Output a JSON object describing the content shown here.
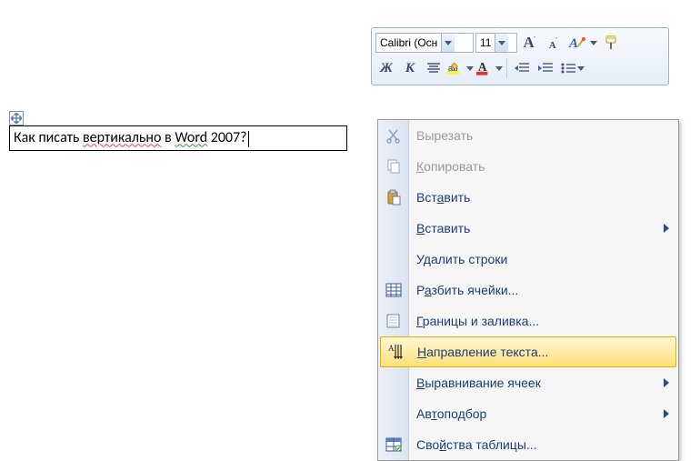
{
  "toolbar": {
    "font_name": "Calibri (Осн",
    "font_size": "11"
  },
  "cell": {
    "text_plain": "Как писать вертикально в Word 2007?",
    "t1": "Как писать ",
    "t2": "вертикально",
    "t3": " в ",
    "t4": "Word",
    "t5": " 2007?"
  },
  "menu": {
    "cut_pre": "В",
    "cut_post": "ырезать",
    "copy_pre": "К",
    "copy_post": "опировать",
    "paste1_pre": "Вст",
    "paste1_u": "а",
    "paste1_post": "вить",
    "paste2_pre": "",
    "paste2_u": "В",
    "paste2_post": "ставить",
    "delrows": "Удалить строки",
    "split_pre": "Р",
    "split_u": "а",
    "split_post": "збить ячейки...",
    "borders_pre": "",
    "borders_u": "Г",
    "borders_post": "раницы и заливка...",
    "dir_pre": "",
    "dir_u": "Н",
    "dir_post": "аправление текста...",
    "align_pre": "",
    "align_u": "В",
    "align_post": "ыравнивание ячеек",
    "autofit_pre": "Ав",
    "autofit_u": "т",
    "autofit_post": "оподбор",
    "props_pre": "Сво",
    "props_u": "й",
    "props_post": "ства таблицы..."
  }
}
